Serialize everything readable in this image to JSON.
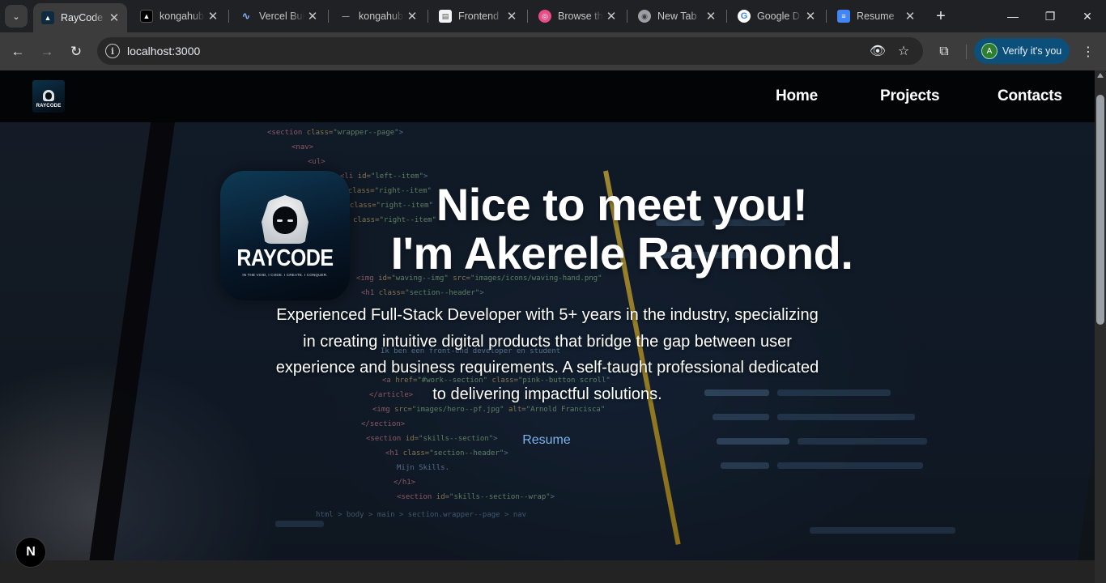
{
  "browser": {
    "tabs": [
      {
        "title": "RayCode",
        "active": true,
        "favicon": "raycode-logo"
      },
      {
        "title": "kongahub",
        "favicon": "vercel-triangle"
      },
      {
        "title": "Vercel Bui",
        "favicon": "vercel-bolt"
      },
      {
        "title": "kongahub",
        "favicon": "blank-page"
      },
      {
        "title": "Frontend",
        "favicon": "document-page"
      },
      {
        "title": "Browse th",
        "favicon": "dribbble-ball"
      },
      {
        "title": "New Tab",
        "favicon": "chrome-logo"
      },
      {
        "title": "Google D",
        "favicon": "google-g"
      },
      {
        "title": "Resume",
        "favicon": "google-docs"
      }
    ],
    "address": "localhost:3000",
    "profile_button": "Verify it's you",
    "profile_initial": "A",
    "accent_color": "#0b4f7a"
  },
  "site": {
    "logo_text": "RAYCODE",
    "logo_tagline": "IN THE VOID, I CODE. I CREATE. I CONQUER.",
    "nav": [
      {
        "label": "Home"
      },
      {
        "label": "Projects"
      },
      {
        "label": "Contacts"
      }
    ],
    "hero": {
      "title_line1": "Nice to meet you!",
      "title_line2": "I'm Akerele Raymond.",
      "description": "Experienced Full-Stack Developer with 5+ years in the industry, specializing in creating intuitive digital products that bridge the gap between user experience and business requirements. A self-taught professional dedicated to delivering impactful solutions.",
      "resume_link": "Resume"
    },
    "dev_badge": "N",
    "link_color": "#7cb3ec"
  }
}
